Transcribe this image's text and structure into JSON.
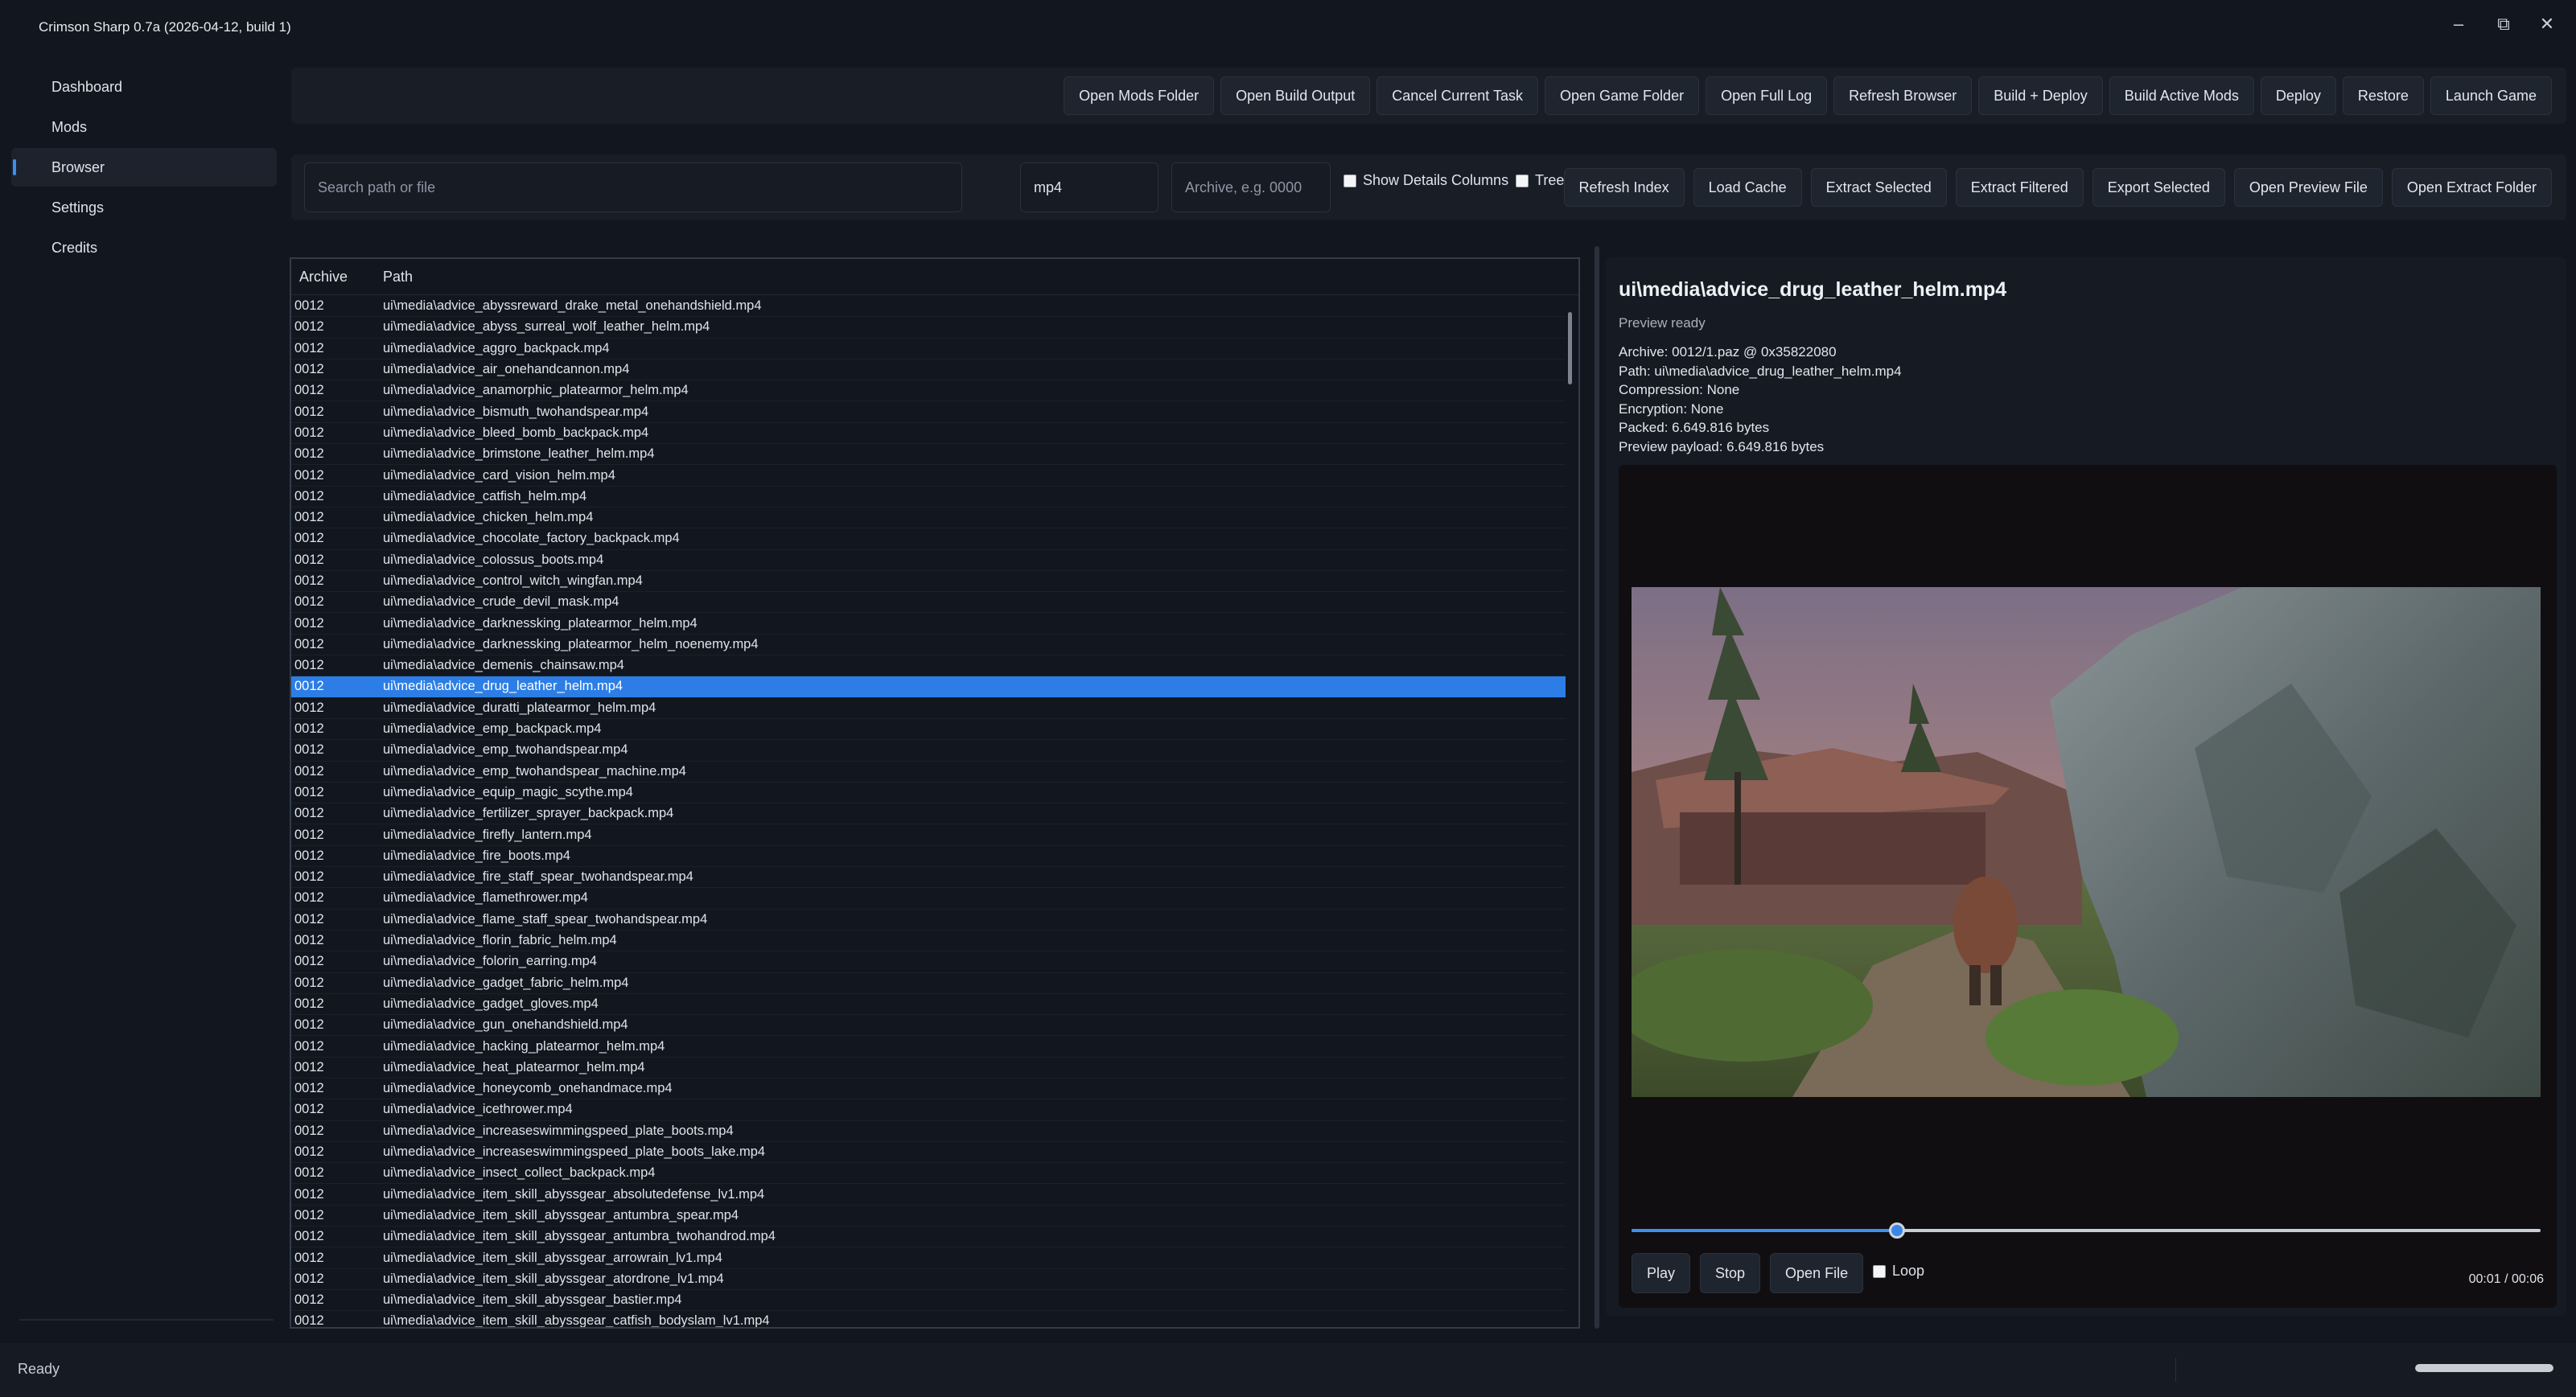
{
  "app": {
    "title": "Crimson Sharp 0.7a (2026-04-12, build 1)"
  },
  "window_controls": {
    "minimize": "–",
    "maximize": "⧉",
    "close": "✕"
  },
  "sidebar": {
    "items": [
      {
        "label": "Dashboard",
        "active": false
      },
      {
        "label": "Mods",
        "active": false
      },
      {
        "label": "Browser",
        "active": true
      },
      {
        "label": "Settings",
        "active": false
      },
      {
        "label": "Credits",
        "active": false
      }
    ]
  },
  "toolbar": {
    "buttons": [
      "Open Mods Folder",
      "Open Build Output",
      "Cancel Current Task",
      "Open Game Folder",
      "Open Full Log",
      "Refresh Browser",
      "Build + Deploy",
      "Build Active Mods",
      "Deploy",
      "Restore",
      "Launch Game"
    ]
  },
  "filter": {
    "search_placeholder": "Search path or file",
    "extension_value": "mp4",
    "archive_placeholder": "Archive, e.g. 0000",
    "show_details_label": "Show Details Columns",
    "show_details_checked": false,
    "tree_view_label": "Tree View",
    "tree_view_checked": false,
    "buttons": [
      "Refresh Index",
      "Load Cache",
      "Extract Selected",
      "Extract Filtered",
      "Export Selected",
      "Open Preview File",
      "Open Extract Folder"
    ]
  },
  "file_list": {
    "columns": [
      "Archive",
      "Path"
    ],
    "selected_index": 18,
    "rows": [
      [
        "0012",
        "ui\\media\\advice_abyssreward_drake_metal_onehandshield.mp4"
      ],
      [
        "0012",
        "ui\\media\\advice_abyss_surreal_wolf_leather_helm.mp4"
      ],
      [
        "0012",
        "ui\\media\\advice_aggro_backpack.mp4"
      ],
      [
        "0012",
        "ui\\media\\advice_air_onehandcannon.mp4"
      ],
      [
        "0012",
        "ui\\media\\advice_anamorphic_platearmor_helm.mp4"
      ],
      [
        "0012",
        "ui\\media\\advice_bismuth_twohandspear.mp4"
      ],
      [
        "0012",
        "ui\\media\\advice_bleed_bomb_backpack.mp4"
      ],
      [
        "0012",
        "ui\\media\\advice_brimstone_leather_helm.mp4"
      ],
      [
        "0012",
        "ui\\media\\advice_card_vision_helm.mp4"
      ],
      [
        "0012",
        "ui\\media\\advice_catfish_helm.mp4"
      ],
      [
        "0012",
        "ui\\media\\advice_chicken_helm.mp4"
      ],
      [
        "0012",
        "ui\\media\\advice_chocolate_factory_backpack.mp4"
      ],
      [
        "0012",
        "ui\\media\\advice_colossus_boots.mp4"
      ],
      [
        "0012",
        "ui\\media\\advice_control_witch_wingfan.mp4"
      ],
      [
        "0012",
        "ui\\media\\advice_crude_devil_mask.mp4"
      ],
      [
        "0012",
        "ui\\media\\advice_darknessking_platearmor_helm.mp4"
      ],
      [
        "0012",
        "ui\\media\\advice_darknessking_platearmor_helm_noenemy.mp4"
      ],
      [
        "0012",
        "ui\\media\\advice_demenis_chainsaw.mp4"
      ],
      [
        "0012",
        "ui\\media\\advice_drug_leather_helm.mp4"
      ],
      [
        "0012",
        "ui\\media\\advice_duratti_platearmor_helm.mp4"
      ],
      [
        "0012",
        "ui\\media\\advice_emp_backpack.mp4"
      ],
      [
        "0012",
        "ui\\media\\advice_emp_twohandspear.mp4"
      ],
      [
        "0012",
        "ui\\media\\advice_emp_twohandspear_machine.mp4"
      ],
      [
        "0012",
        "ui\\media\\advice_equip_magic_scythe.mp4"
      ],
      [
        "0012",
        "ui\\media\\advice_fertilizer_sprayer_backpack.mp4"
      ],
      [
        "0012",
        "ui\\media\\advice_firefly_lantern.mp4"
      ],
      [
        "0012",
        "ui\\media\\advice_fire_boots.mp4"
      ],
      [
        "0012",
        "ui\\media\\advice_fire_staff_spear_twohandspear.mp4"
      ],
      [
        "0012",
        "ui\\media\\advice_flamethrower.mp4"
      ],
      [
        "0012",
        "ui\\media\\advice_flame_staff_spear_twohandspear.mp4"
      ],
      [
        "0012",
        "ui\\media\\advice_florin_fabric_helm.mp4"
      ],
      [
        "0012",
        "ui\\media\\advice_folorin_earring.mp4"
      ],
      [
        "0012",
        "ui\\media\\advice_gadget_fabric_helm.mp4"
      ],
      [
        "0012",
        "ui\\media\\advice_gadget_gloves.mp4"
      ],
      [
        "0012",
        "ui\\media\\advice_gun_onehandshield.mp4"
      ],
      [
        "0012",
        "ui\\media\\advice_hacking_platearmor_helm.mp4"
      ],
      [
        "0012",
        "ui\\media\\advice_heat_platearmor_helm.mp4"
      ],
      [
        "0012",
        "ui\\media\\advice_honeycomb_onehandmace.mp4"
      ],
      [
        "0012",
        "ui\\media\\advice_icethrower.mp4"
      ],
      [
        "0012",
        "ui\\media\\advice_increaseswimmingspeed_plate_boots.mp4"
      ],
      [
        "0012",
        "ui\\media\\advice_increaseswimmingspeed_plate_boots_lake.mp4"
      ],
      [
        "0012",
        "ui\\media\\advice_insect_collect_backpack.mp4"
      ],
      [
        "0012",
        "ui\\media\\advice_item_skill_abyssgear_absolutedefense_lv1.mp4"
      ],
      [
        "0012",
        "ui\\media\\advice_item_skill_abyssgear_antumbra_spear.mp4"
      ],
      [
        "0012",
        "ui\\media\\advice_item_skill_abyssgear_antumbra_twohandrod.mp4"
      ],
      [
        "0012",
        "ui\\media\\advice_item_skill_abyssgear_arrowrain_lv1.mp4"
      ],
      [
        "0012",
        "ui\\media\\advice_item_skill_abyssgear_atordrone_lv1.mp4"
      ],
      [
        "0012",
        "ui\\media\\advice_item_skill_abyssgear_bastier.mp4"
      ],
      [
        "0012",
        "ui\\media\\advice_item_skill_abyssgear_catfish_bodyslam_lv1.mp4"
      ]
    ]
  },
  "preview": {
    "title": "ui\\media\\advice_drug_leather_helm.mp4",
    "status": "Preview ready",
    "info": [
      "Archive: 0012/1.paz @ 0x35822080",
      "Path: ui\\media\\advice_drug_leather_helm.mp4",
      "Compression: None",
      "Encryption: None",
      "Packed: 6.649.816 bytes",
      "Preview payload: 6.649.816 bytes"
    ],
    "seek_fraction": 0.292,
    "buttons": [
      "Play",
      "Stop",
      "Open File"
    ],
    "loop_label": "Loop",
    "loop_checked": false,
    "time": "00:01 / 00:06"
  },
  "status": {
    "text": "Ready",
    "progress": 1.0
  },
  "colors": {
    "accent": "#2c7ee6",
    "background": "#12161e",
    "panel": "#181d26"
  }
}
